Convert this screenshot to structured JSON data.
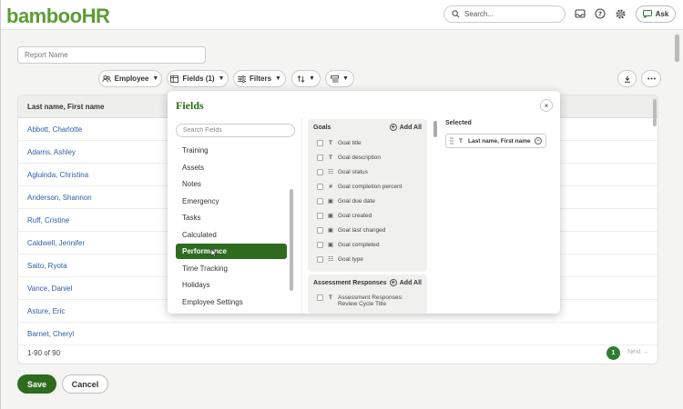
{
  "header": {
    "logo_prefix": "bamboo",
    "logo_suffix": "HR",
    "search_placeholder": "Search...",
    "ask_label": "Ask"
  },
  "report": {
    "name_placeholder": "Report Name",
    "toolbar": {
      "employee_label": "Employee",
      "fields_label": "Fields (1)",
      "filters_label": "Filters"
    },
    "column_header": "Last name, First name",
    "rows": [
      "Abbott, Charlotte",
      "Adams, Ashley",
      "Agluinda, Christina",
      "Anderson, Shannon",
      "Ruff, Cristine",
      "Caldwell, Jennifer",
      "Saito, Ryota",
      "Vance, Daniel",
      "Asture, Eric",
      "Barnet, Cheryl"
    ],
    "count_label": "1-90 of 90",
    "page_number": "1",
    "next_label": "Next →"
  },
  "actions": {
    "save_label": "Save",
    "cancel_label": "Cancel"
  },
  "fields_popover": {
    "title": "Fields",
    "close_glyph": "×",
    "search_placeholder": "Search Fields",
    "categories": [
      {
        "label": "Training",
        "active": false
      },
      {
        "label": "Assets",
        "active": false
      },
      {
        "label": "Notes",
        "active": false
      },
      {
        "label": "Emergency",
        "active": false
      },
      {
        "label": "Tasks",
        "active": false
      },
      {
        "label": "Calculated",
        "active": false
      },
      {
        "label": "Performance",
        "active": true
      },
      {
        "label": "Time Tracking",
        "active": false
      },
      {
        "label": "Holidays",
        "active": false
      },
      {
        "label": "Employee Settings",
        "active": false
      }
    ],
    "goals": {
      "heading": "Goals",
      "add_all_label": "Add All",
      "fields": [
        {
          "type": "text",
          "glyph": "T",
          "label": "Goal title"
        },
        {
          "type": "text",
          "glyph": "T",
          "label": "Goal description"
        },
        {
          "type": "list",
          "glyph": "☷",
          "label": "Goal status"
        },
        {
          "type": "number",
          "glyph": "#",
          "label": "Goal completion percent"
        },
        {
          "type": "date",
          "glyph": "▣",
          "label": "Goal due date"
        },
        {
          "type": "date",
          "glyph": "▣",
          "label": "Goal created"
        },
        {
          "type": "date",
          "glyph": "▣",
          "label": "Goal last changed"
        },
        {
          "type": "date",
          "glyph": "▣",
          "label": "Goal completed"
        },
        {
          "type": "list",
          "glyph": "☷",
          "label": "Goal type"
        }
      ]
    },
    "assessment": {
      "heading": "Assessment Responses",
      "add_all_label": "Add All",
      "first_field": "Assessment Responses: Review Cycle Title"
    },
    "selected_heading": "Selected",
    "selected_fields": [
      "Last name, First name"
    ]
  },
  "colors": {
    "brand_green": "#5a9e32",
    "primary_dark_green": "#2e6b1f",
    "link_blue": "#2b5ea7"
  }
}
